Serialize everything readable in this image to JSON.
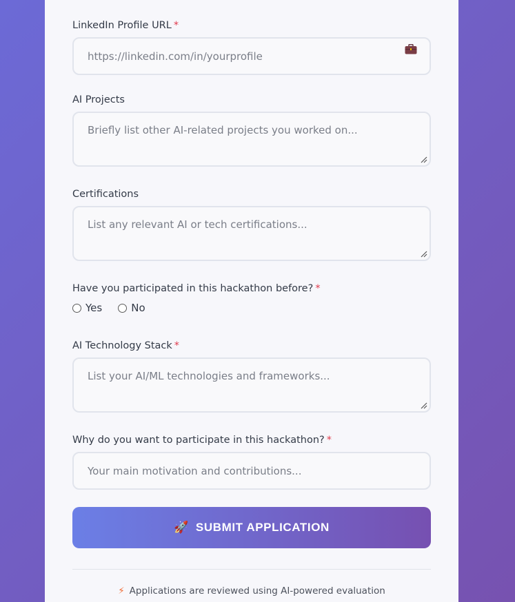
{
  "form": {
    "linkedin": {
      "label": "LinkedIn Profile URL",
      "required_mark": "*",
      "placeholder": "https://linkedin.com/in/yourprofile",
      "icon": "briefcase-icon"
    },
    "ai_projects": {
      "label": "AI Projects",
      "placeholder": "Briefly list other AI-related projects you worked on..."
    },
    "certifications": {
      "label": "Certifications",
      "placeholder": "List any relevant AI or tech certifications..."
    },
    "participated": {
      "label": "Have you participated in this hackathon before?",
      "required_mark": "*",
      "options": [
        "Yes",
        "No"
      ]
    },
    "stack": {
      "label": "AI Technology Stack",
      "required_mark": "*",
      "placeholder": "List your AI/ML technologies and frameworks..."
    },
    "why": {
      "label": "Why do you want to participate in this hackathon?",
      "required_mark": "*",
      "placeholder": "Your main motivation and contributions..."
    },
    "submit": {
      "icon": "🚀",
      "label": "SUBMIT APPLICATION"
    }
  },
  "footer": {
    "note_1_icon": "⚡",
    "note_1": "Applications are reviewed using AI-powered evaluation"
  },
  "colors": {
    "required": "#e03b4d",
    "button_start": "#6b7fe6",
    "button_end": "#7650b1"
  }
}
